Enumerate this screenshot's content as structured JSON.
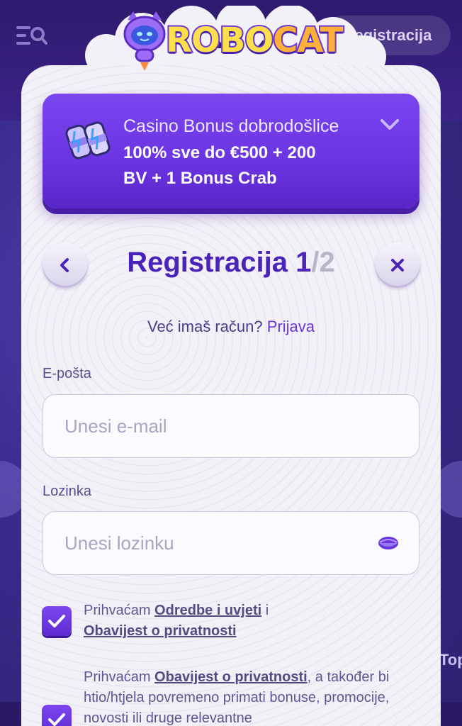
{
  "background": {
    "register_button": "Registracija",
    "side_text": "Top"
  },
  "logo": {
    "text_part1": "ROBO",
    "text_part2": "CAT"
  },
  "bonus": {
    "title": "Casino Bonus dobrodošlice",
    "line1": "100% sve do €500 + 200",
    "line2": "BV + 1 Bonus Crab"
  },
  "registration": {
    "title": "Registracija",
    "step_current": "1",
    "step_total": "/2",
    "have_account": "Već imaš račun?",
    "login_link": "Prijava"
  },
  "form": {
    "email_label": "E-pošta",
    "email_placeholder": "Unesi e-mail",
    "password_label": "Lozinka",
    "password_placeholder": "Unesi lozinku"
  },
  "consents": {
    "c1_prefix": "Prihvaćam",
    "c1_link1": "Odredbe i uvjeti",
    "c1_mid": "i",
    "c1_link2": "Obavijest o privatnosti",
    "c2_prefix": "Prihvaćam",
    "c2_link": "Obavijest o privatnosti",
    "c2_text": ", a također bi htio/htjela povremeno primati bonuse, promocije, novosti ili druge relevantne"
  },
  "colors": {
    "accent": "#6b35e0",
    "title": "#4a23b8",
    "card": "#f3f1f8"
  }
}
